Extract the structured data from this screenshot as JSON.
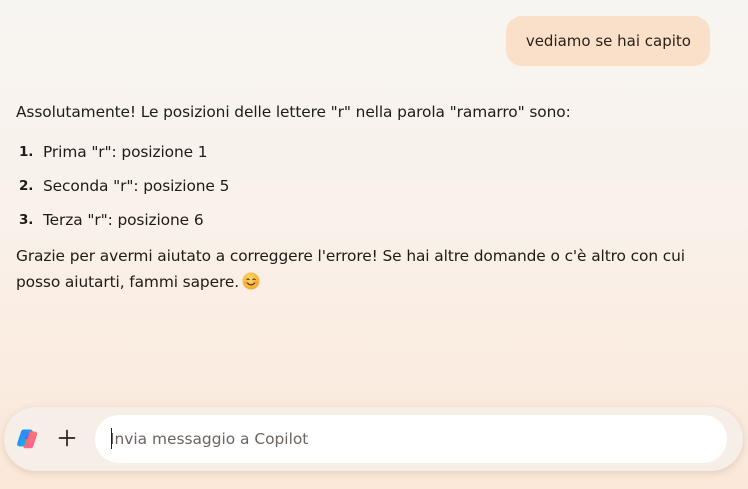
{
  "colors": {
    "user_bubble": "#fbe0c9",
    "text": "#1f1b16",
    "composer_bg": "#f6efe8",
    "input_bg": "#ffffff"
  },
  "conversation": {
    "user_message": "vediamo se hai capito",
    "assistant": {
      "intro": "Assolutamente! Le posizioni delle lettere \"r\" nella parola \"ramarro\" sono:",
      "list": [
        {
          "num": "1.",
          "text": "Prima \"r\": posizione 1"
        },
        {
          "num": "2.",
          "text": "Seconda \"r\": posizione 5"
        },
        {
          "num": "3.",
          "text": "Terza \"r\": posizione 6"
        }
      ],
      "outro": "Grazie per avermi aiutato a correggere l'errore! Se hai altre domande o c'è altro con cui posso aiutarti, fammi sapere.",
      "emoji": "smiling-face-emoji"
    }
  },
  "composer": {
    "placeholder": "Invia messaggio a Copilot",
    "value": "",
    "copilot_icon": "copilot-logo-icon",
    "plus_icon": "plus-icon"
  }
}
